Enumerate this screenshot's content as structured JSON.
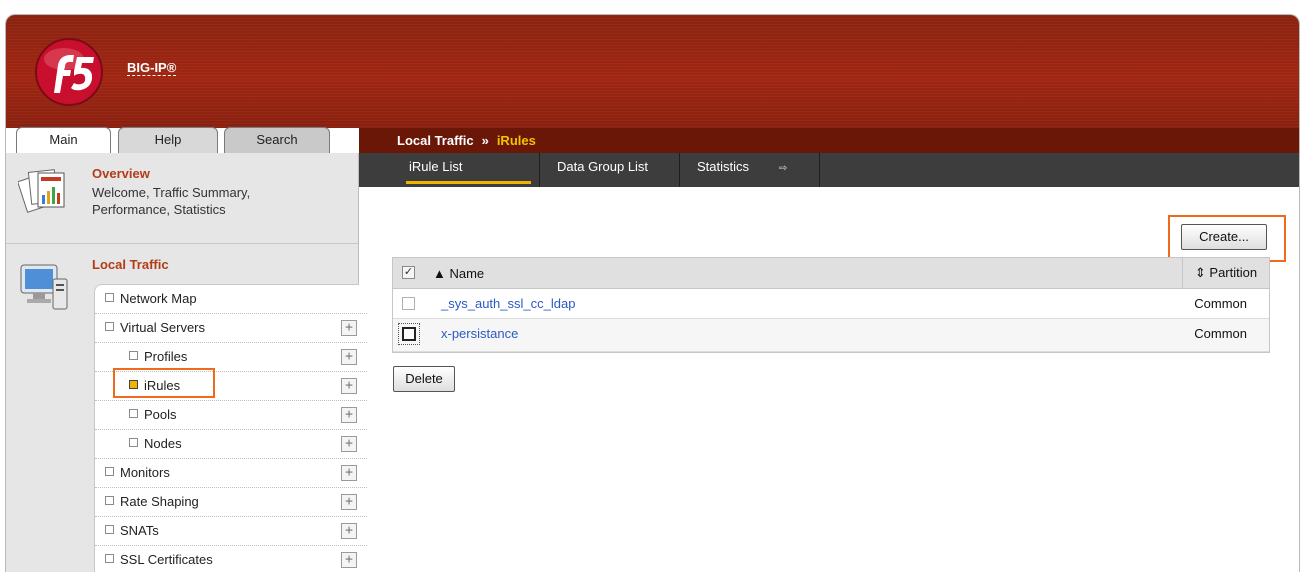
{
  "app": {
    "product": "BIG-IP®"
  },
  "tabs": {
    "main": "Main",
    "help": "Help",
    "search": "Search"
  },
  "breadcrumb": {
    "section": "Local Traffic",
    "separator": "»",
    "current": "iRules"
  },
  "subtabs": [
    {
      "label": "iRule List",
      "active": true
    },
    {
      "label": "Data Group List",
      "active": false
    },
    {
      "label": "Statistics",
      "active": false,
      "more": "⇨"
    }
  ],
  "sidebar": {
    "overview": {
      "title": "Overview",
      "desc_line1": "Welcome, Traffic Summary,",
      "desc_line2": "Performance, Statistics"
    },
    "local_traffic": {
      "title": "Local Traffic",
      "items": [
        {
          "label": "Network Map",
          "level": 0,
          "expand": false,
          "selected": false
        },
        {
          "label": "Virtual Servers",
          "level": 0,
          "expand": true,
          "selected": false
        },
        {
          "label": "Profiles",
          "level": 1,
          "expand": true,
          "selected": false
        },
        {
          "label": "iRules",
          "level": 1,
          "expand": true,
          "selected": true
        },
        {
          "label": "Pools",
          "level": 1,
          "expand": true,
          "selected": false
        },
        {
          "label": "Nodes",
          "level": 1,
          "expand": true,
          "selected": false
        },
        {
          "label": "Monitors",
          "level": 0,
          "expand": true,
          "selected": false
        },
        {
          "label": "Rate Shaping",
          "level": 0,
          "expand": true,
          "selected": false
        },
        {
          "label": "SNATs",
          "level": 0,
          "expand": true,
          "selected": false
        },
        {
          "label": "SSL Certificates",
          "level": 0,
          "expand": true,
          "selected": false
        }
      ],
      "plus": "+"
    }
  },
  "content": {
    "create_label": "Create...",
    "delete_label": "Delete",
    "table": {
      "header_check": "✓",
      "columns": {
        "name": "▲ Name",
        "partition": "⇕ Partition"
      },
      "rows": [
        {
          "name": "_sys_auth_ssl_cc_ldap",
          "partition": "Common"
        },
        {
          "name": "x-persistance",
          "partition": "Common"
        }
      ]
    }
  },
  "colors": {
    "brand_red": "#9f2612",
    "accent_yellow": "#f0b400",
    "highlight_orange": "#ef6a1e",
    "link_blue": "#2b59c3"
  }
}
